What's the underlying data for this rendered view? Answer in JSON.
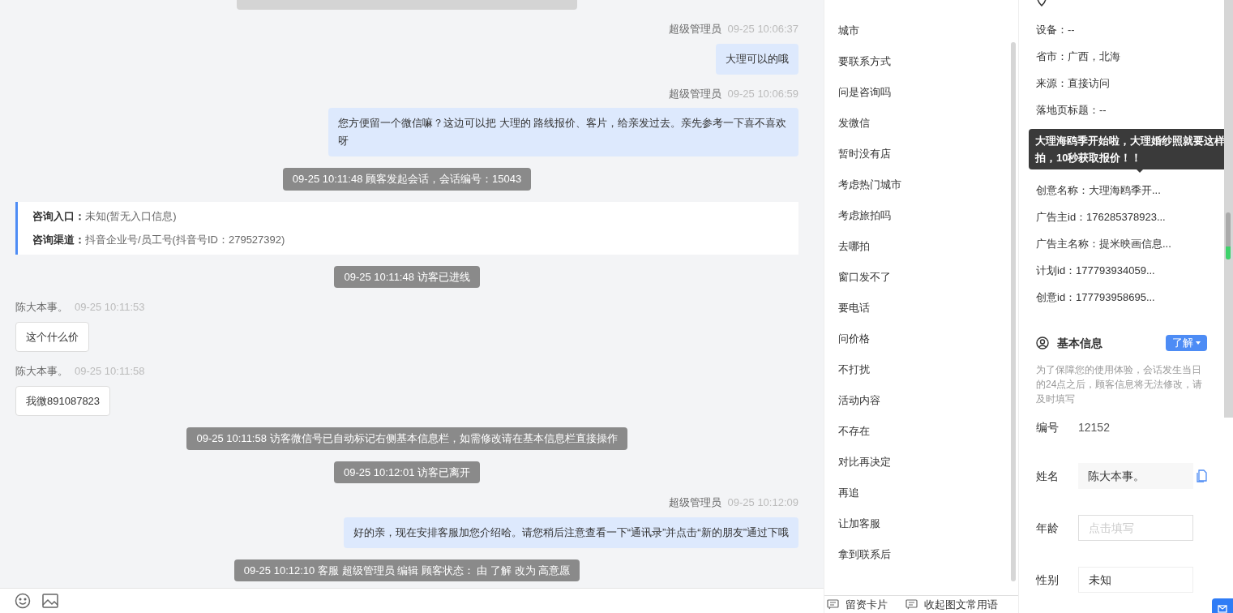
{
  "chat": {
    "messages": [
      {
        "kind": "clipped_system"
      },
      {
        "kind": "agent",
        "sender": "超级管理员",
        "time": "09-25 10:06:37",
        "text": "大理可以的哦"
      },
      {
        "kind": "agent",
        "sender": "超级管理员",
        "time": "09-25 10:06:59",
        "text": "您方便留一个微信嘛？这边可以把 大理的 路线报价、客片，给亲发过去。亲先参考一下喜不喜欢呀"
      },
      {
        "kind": "system",
        "text": "09-25 10:11:48 顾客发起会话，会话编号：15043"
      },
      {
        "kind": "info",
        "lines": [
          {
            "label": "咨询入口：",
            "value": "未知(暂无入口信息)"
          },
          {
            "label": "咨询渠道：",
            "value": "抖音企业号/员工号(抖音号ID：279527392)"
          }
        ]
      },
      {
        "kind": "system",
        "text": "09-25 10:11:48 访客已进线"
      },
      {
        "kind": "visitor",
        "sender": "陈大本事。",
        "time": "09-25 10:11:53",
        "text": "这个什么价"
      },
      {
        "kind": "visitor",
        "sender": "陈大本事。",
        "time": "09-25 10:11:58",
        "text": "我微891087823"
      },
      {
        "kind": "system",
        "text": "09-25 10:11:58 访客微信号已自动标记右侧基本信息栏，如需修改请在基本信息栏直接操作"
      },
      {
        "kind": "system",
        "text": "09-25 10:12:01 访客已离开"
      },
      {
        "kind": "agent",
        "sender": "超级管理员",
        "time": "09-25 10:12:09",
        "text": "好的亲，现在安排客服加您介绍哈。请您稍后注意查看一下“通讯录”并点击“新的朋友”通过下哦"
      },
      {
        "kind": "system",
        "text": "09-25 10:12:10 客服 超级管理员 编辑 顾客状态： 由 了解 改为 高意愿"
      }
    ]
  },
  "phrases": {
    "items": [
      "城市",
      "要联系方式",
      "问是咨询吗",
      "发微信",
      "暂时没有店",
      "考虑热门城市",
      "考虑旅拍吗",
      "去哪拍",
      "窗口发不了",
      "要电话",
      "问价格",
      "不打扰",
      "活动内容",
      "不存在",
      "对比再决定",
      "再追",
      "让加客服",
      "拿到联系后"
    ],
    "footer": [
      "留资卡片",
      "收起图文常用语"
    ]
  },
  "source_info": {
    "rows": [
      {
        "kind": "text",
        "text": "设备：--"
      },
      {
        "kind": "text",
        "text": "省市：广西，北海"
      },
      {
        "kind": "text",
        "text": "来源：直接访问"
      },
      {
        "kind": "text",
        "text": "落地页标题：--"
      },
      {
        "kind": "hidden"
      },
      {
        "kind": "hidden"
      },
      {
        "kind": "text",
        "text": "创意名称：大理海鸥季开..."
      },
      {
        "kind": "text",
        "text": "广告主id：176285378923..."
      },
      {
        "kind": "text",
        "text": "广告主名称：提米映画信息..."
      },
      {
        "kind": "text",
        "text": "计划id：177793934059..."
      },
      {
        "kind": "text",
        "text": "创意id：177793958695..."
      }
    ],
    "tooltip": "大理海鸥季开始啦，大理婚纱照就要这样拍，10秒获取报价！！"
  },
  "basic_info": {
    "title": "基本信息",
    "status": "了解",
    "notice": "为了保障您的使用体验，会话发生当日的24点之后，顾客信息将无法修改，请及时填写",
    "fields": [
      {
        "kind": "static",
        "label": "编号",
        "value": "12152"
      },
      {
        "kind": "filled",
        "label": "姓名",
        "value": "陈大本事。"
      },
      {
        "kind": "input",
        "label": "年龄",
        "placeholder": "点击填写"
      },
      {
        "kind": "select",
        "label": "性别",
        "value": "未知"
      }
    ]
  }
}
